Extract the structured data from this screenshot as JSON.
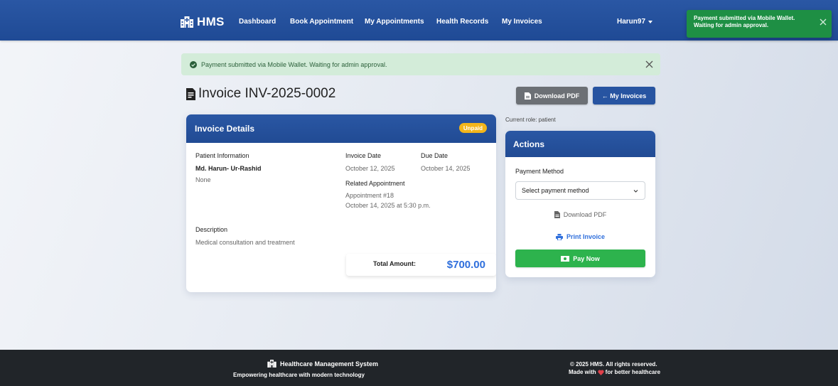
{
  "nav": {
    "brand": "HMS",
    "links": [
      "Dashboard",
      "Book Appointment",
      "My Appointments",
      "Health Records",
      "My Invoices"
    ],
    "user": "Harun97"
  },
  "toast": {
    "message": "Payment submitted via Mobile Wallet. Waiting for admin approval."
  },
  "alert": {
    "message": "Payment submitted via Mobile Wallet. Waiting for admin approval."
  },
  "page": {
    "title": "Invoice INV-2025-0002",
    "download_pdf": "Download PDF",
    "my_invoices": "← My Invoices",
    "current_role": "Current role: patient"
  },
  "invoice": {
    "header": "Invoice Details",
    "status": "Unpaid",
    "patient_info_label": "Patient Information",
    "patient_name": "Md. Harun- Ur-Rashid",
    "patient_extra": "None",
    "invoice_date_label": "Invoice Date",
    "invoice_date": "October 12, 2025",
    "due_date_label": "Due Date",
    "due_date": "October 14, 2025",
    "related_label": "Related Appointment",
    "appointment_id": "Appointment #18",
    "appointment_time": "October 14, 2025 at 5:30 p.m.",
    "description_label": "Description",
    "description": "Medical consultation and treatment",
    "total_label": "Total Amount:",
    "total_value": "$700.00"
  },
  "actions": {
    "header": "Actions",
    "payment_method_label": "Payment Method",
    "payment_method_selected": "Select payment method",
    "download_pdf": "Download PDF",
    "print_invoice": "Print Invoice",
    "pay_now": "Pay Now"
  },
  "footer": {
    "title": "Healthcare Management System",
    "tagline": "Empowering healthcare with modern technology",
    "copyright": "© 2025 HMS. All rights reserved.",
    "made_with_prefix": "Made with",
    "made_with_suffix": "for better healthcare"
  },
  "colors": {
    "primary": "#2a57a4",
    "success": "#2db34d",
    "toast": "#1e8f44",
    "warning": "#f2b51b",
    "link": "#2f6fdc",
    "footer": "#212529"
  },
  "icons": [
    "hospital-icon",
    "close-icon",
    "check-circle-icon",
    "file-invoice-icon",
    "pdf-icon",
    "chevron-down-icon",
    "print-icon",
    "money-icon",
    "heart-icon"
  ]
}
